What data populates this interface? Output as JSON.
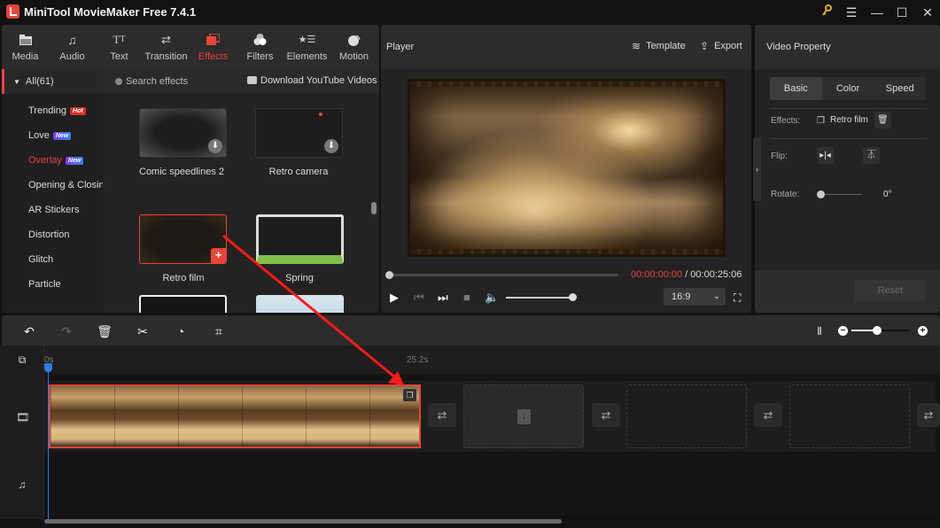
{
  "window": {
    "title": "MiniTool MovieMaker Free 7.4.1",
    "controls": [
      "key-icon",
      "menu-icon",
      "minimize-icon",
      "maximize-icon",
      "close-icon"
    ]
  },
  "topnav": {
    "items": [
      {
        "label": "Media",
        "icon": "folder-icon"
      },
      {
        "label": "Audio",
        "icon": "music-note-icon"
      },
      {
        "label": "Text",
        "icon": "text-icon"
      },
      {
        "label": "Transition",
        "icon": "swap-arrows-icon"
      },
      {
        "label": "Effects",
        "icon": "effects-icon",
        "active": true
      },
      {
        "label": "Filters",
        "icon": "filters-icon"
      },
      {
        "label": "Elements",
        "icon": "elements-icon"
      },
      {
        "label": "Motion",
        "icon": "motion-icon"
      }
    ]
  },
  "categories": {
    "all_label": "All(61)",
    "items": [
      {
        "label": "Trending",
        "badge": "Hot"
      },
      {
        "label": "Love",
        "badge": "New"
      },
      {
        "label": "Overlay",
        "badge": "New",
        "active": true
      },
      {
        "label": "Opening & Closing"
      },
      {
        "label": "AR Stickers"
      },
      {
        "label": "Distortion"
      },
      {
        "label": "Glitch"
      },
      {
        "label": "Particle"
      }
    ]
  },
  "search": {
    "placeholder": "Search effects",
    "download_label": "Download YouTube Videos"
  },
  "effects": [
    {
      "label": "Comic speedlines 2",
      "action": "download"
    },
    {
      "label": "Retro camera",
      "action": "download"
    },
    {
      "label": "Retro film",
      "action": "add",
      "selected": true
    },
    {
      "label": "Spring"
    },
    {
      "label": ""
    },
    {
      "label": ""
    }
  ],
  "player": {
    "title": "Player",
    "template_label": "Template",
    "export_label": "Export",
    "current_time": "00:00:00:00",
    "separator": " / ",
    "total_time": "00:00:25:06",
    "aspect_ratio": "16:9",
    "progress": 0,
    "volume": 1.0
  },
  "properties": {
    "title": "Video Property",
    "tabs": [
      "Basic",
      "Color",
      "Speed"
    ],
    "active_tab": "Basic",
    "effects_label": "Effects:",
    "effect_name": "Retro film",
    "flip_label": "Flip:",
    "rotate_label": "Rotate:",
    "rotate_value": "0°",
    "reset_label": "Reset"
  },
  "timeline": {
    "ruler_start": "0s",
    "ruler_mark": "25.2s",
    "zoom_level": 0.45
  },
  "colors": {
    "accent": "#e8443a",
    "playhead": "#2f7be8",
    "background": "#121212",
    "panel": "#232323"
  }
}
